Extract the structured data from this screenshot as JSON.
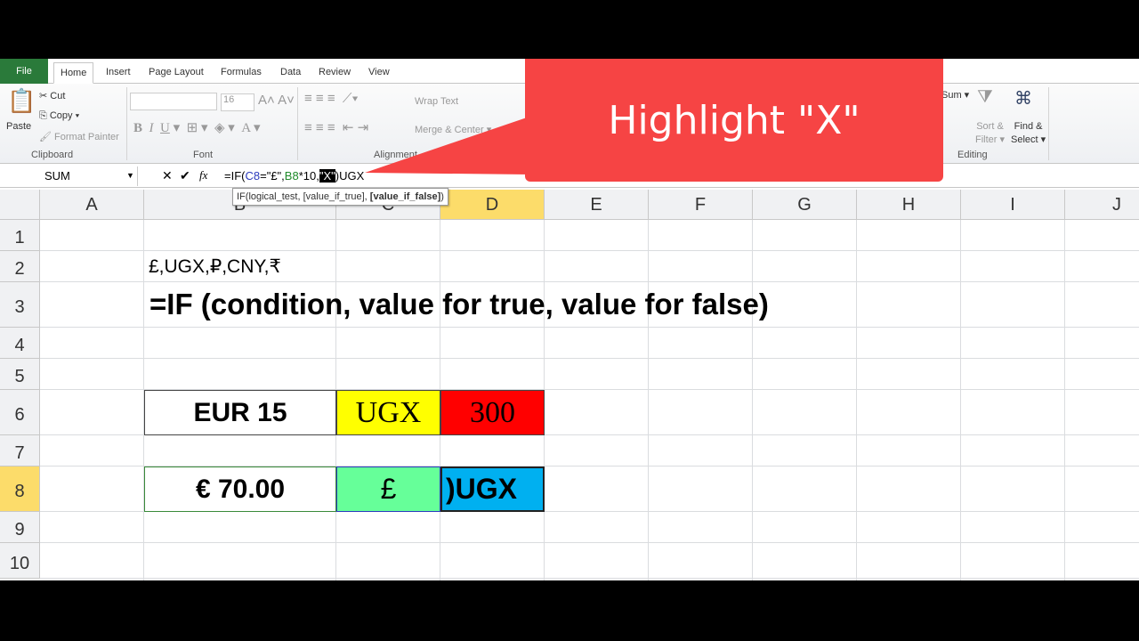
{
  "ribbon_tabs": [
    "File",
    "Home",
    "Insert",
    "Page Layout",
    "Formulas",
    "Data",
    "Review",
    "View"
  ],
  "clipboard": {
    "paste": "Paste",
    "cut": "Cut",
    "copy": "Copy ▾",
    "format_painter": "Format Painter",
    "label": "Clipboard"
  },
  "font": {
    "size": "16",
    "label": "Font"
  },
  "alignment": {
    "wrap": "Wrap Text",
    "merge": "Merge & Center ▾",
    "label": "Alignment"
  },
  "editing": {
    "sum": "Sum ▾",
    "sort1": "Sort &",
    "sort2": "Filter ▾",
    "find1": "Find &",
    "find2": "Select ▾",
    "label": "Editing"
  },
  "formula_bar": {
    "name_box": "SUM",
    "fx": "fx",
    "formula_parts": [
      "=IF(",
      "C8",
      "=\"£\",",
      "B8",
      "*10,",
      "\"X\"",
      ")UGX"
    ],
    "tooltip_plain": "IF(logical_test, [value_if_true], ",
    "tooltip_bold": "[value_if_false]",
    ")": ")"
  },
  "columns": [
    "A",
    "B",
    "C",
    "D",
    "E",
    "F",
    "G",
    "H",
    "I",
    "J"
  ],
  "rows": [
    "1",
    "2",
    "3",
    "4",
    "5",
    "6",
    "7",
    "8",
    "9",
    "10"
  ],
  "cells": {
    "B2": "£,UGX,₽,CNY,₹",
    "B3": "=IF (condition, value for true, value for false)",
    "B6": "EUR 15",
    "C6": "UGX",
    "D6": "300",
    "B8": "€ 70.00",
    "C8": "£",
    "D8": ")UGX"
  },
  "callout": "Highlight \"X\"",
  "colors": {
    "yellow": "#ffff00",
    "red": "#ff0000",
    "green": "#66ff99",
    "blue": "#00b0f0",
    "callout": "#f64444"
  }
}
